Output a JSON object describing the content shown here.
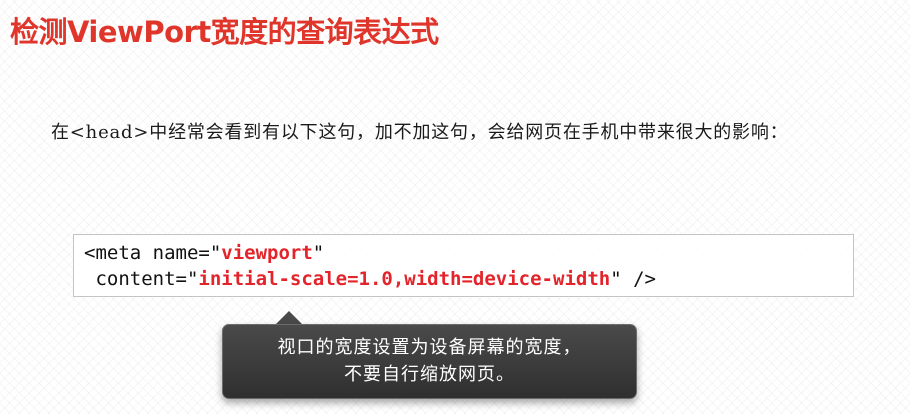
{
  "slide": {
    "title": "检测ViewPort宽度的查询表达式",
    "intro": "在<head>中经常会看到有以下这句，加不加这句，会给网页在手机中带来很大的影响：",
    "code": {
      "line1_prefix": "<meta name=\"",
      "line1_value": "viewport",
      "line1_suffix": "\"",
      "line2_prefix": " content=\"",
      "line2_value": "initial-scale=1.0,width=device-width",
      "line2_suffix": "\" />"
    },
    "callout": {
      "line1": "视口的宽度设置为设备屏幕的宽度，",
      "line2": "不要自行缩放网页。"
    }
  },
  "colors": {
    "title": "#e0352b",
    "code_value": "#e3242b",
    "callout_bg": "#3a3a3a"
  }
}
